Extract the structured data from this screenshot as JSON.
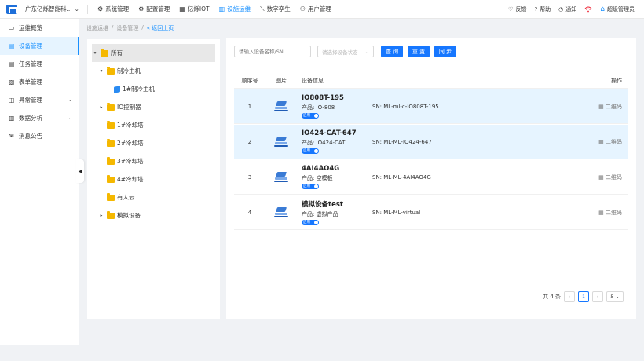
{
  "header": {
    "company": "广东亿烁智能科...",
    "nav": [
      {
        "icon": "⚙",
        "label": "系统管理"
      },
      {
        "icon": "⚙",
        "label": "配置管理"
      },
      {
        "icon": "▦",
        "label": "亿烁IOT"
      },
      {
        "icon": "▥",
        "label": "设施运维"
      },
      {
        "icon": "⟍",
        "label": "数字孪生"
      },
      {
        "icon": "⚇",
        "label": "用户管理"
      }
    ],
    "active_nav": 3,
    "right": [
      {
        "icon": "♡",
        "label": "反馈"
      },
      {
        "icon": "?",
        "label": "帮助"
      },
      {
        "icon": "◔",
        "label": "通知"
      }
    ],
    "user": "超级管理员"
  },
  "sidebar": {
    "items": [
      {
        "icon": "▭",
        "label": "运维概览"
      },
      {
        "icon": "▤",
        "label": "设备管理"
      },
      {
        "icon": "▤",
        "label": "任务管理"
      },
      {
        "icon": "▧",
        "label": "表单管理"
      },
      {
        "icon": "◫",
        "label": "异常管理",
        "chevron": "⌄"
      },
      {
        "icon": "▥",
        "label": "数据分析",
        "chevron": "⌄"
      },
      {
        "icon": "✉",
        "label": "消息公告"
      }
    ],
    "active_index": 1
  },
  "breadcrumb": {
    "items": [
      "设施运维",
      "设备管理"
    ],
    "back": "« 返回上页"
  },
  "tree": {
    "root": "所有",
    "nodes": [
      {
        "label": "制冷主机",
        "level": 1,
        "caret": "▾"
      },
      {
        "label": "1#制冷主机",
        "level": 2,
        "type": "device"
      },
      {
        "label": "IO控制器",
        "level": 1,
        "caret": "▸"
      },
      {
        "label": "1#冷却塔",
        "level": 1
      },
      {
        "label": "2#冷却塔",
        "level": 1
      },
      {
        "label": "3#冷却塔",
        "level": 1
      },
      {
        "label": "4#冷却塔",
        "level": 1
      },
      {
        "label": "有人云",
        "level": 1
      },
      {
        "label": "模拟设备",
        "level": 1,
        "caret": "▸"
      }
    ]
  },
  "filters": {
    "search_placeholder": "请输入设备名称/SN",
    "status_placeholder": "请选择设备状态",
    "query": "查 询",
    "reset": "重 置",
    "sync": "同 步"
  },
  "table": {
    "columns": [
      "顺序号",
      "图片",
      "设备信息",
      "操作"
    ],
    "rows": [
      {
        "idx": "1",
        "name": "IO808T-195",
        "product": "产品: IO-808",
        "sn": "SN: ML-ml-c-IO808T-195",
        "status": "启用",
        "op": "二维码",
        "highlight": true
      },
      {
        "idx": "2",
        "name": "IO424-CAT-647",
        "product": "产品: IO424-CAT",
        "sn": "SN: ML-ML-IO424-647",
        "status": "启用",
        "op": "二维码",
        "highlight": true
      },
      {
        "idx": "3",
        "name": "4AI4AO4G",
        "product": "产品: 空模板",
        "sn": "SN: ML-ML-4AI4AO4G",
        "status": "启用",
        "op": "二维码",
        "highlight": false
      },
      {
        "idx": "4",
        "name": "模拟设备test",
        "product": "产品: 虚拟产品",
        "sn": "SN: ML-ML-virtual",
        "status": "启用",
        "op": "二维码",
        "highlight": false
      }
    ]
  },
  "pagination": {
    "total": "共 4 条",
    "current": "1",
    "page_size": "5"
  }
}
